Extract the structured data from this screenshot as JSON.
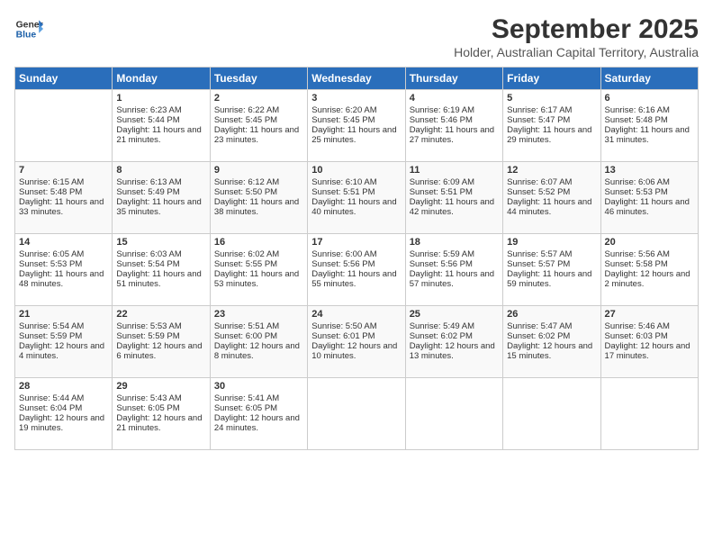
{
  "header": {
    "logo_line1": "General",
    "logo_line2": "Blue",
    "month": "September 2025",
    "location": "Holder, Australian Capital Territory, Australia"
  },
  "days_of_week": [
    "Sunday",
    "Monday",
    "Tuesday",
    "Wednesday",
    "Thursday",
    "Friday",
    "Saturday"
  ],
  "weeks": [
    [
      {
        "day": "",
        "sunrise": "",
        "sunset": "",
        "daylight": ""
      },
      {
        "day": "1",
        "sunrise": "Sunrise: 6:23 AM",
        "sunset": "Sunset: 5:44 PM",
        "daylight": "Daylight: 11 hours and 21 minutes."
      },
      {
        "day": "2",
        "sunrise": "Sunrise: 6:22 AM",
        "sunset": "Sunset: 5:45 PM",
        "daylight": "Daylight: 11 hours and 23 minutes."
      },
      {
        "day": "3",
        "sunrise": "Sunrise: 6:20 AM",
        "sunset": "Sunset: 5:45 PM",
        "daylight": "Daylight: 11 hours and 25 minutes."
      },
      {
        "day": "4",
        "sunrise": "Sunrise: 6:19 AM",
        "sunset": "Sunset: 5:46 PM",
        "daylight": "Daylight: 11 hours and 27 minutes."
      },
      {
        "day": "5",
        "sunrise": "Sunrise: 6:17 AM",
        "sunset": "Sunset: 5:47 PM",
        "daylight": "Daylight: 11 hours and 29 minutes."
      },
      {
        "day": "6",
        "sunrise": "Sunrise: 6:16 AM",
        "sunset": "Sunset: 5:48 PM",
        "daylight": "Daylight: 11 hours and 31 minutes."
      }
    ],
    [
      {
        "day": "7",
        "sunrise": "Sunrise: 6:15 AM",
        "sunset": "Sunset: 5:48 PM",
        "daylight": "Daylight: 11 hours and 33 minutes."
      },
      {
        "day": "8",
        "sunrise": "Sunrise: 6:13 AM",
        "sunset": "Sunset: 5:49 PM",
        "daylight": "Daylight: 11 hours and 35 minutes."
      },
      {
        "day": "9",
        "sunrise": "Sunrise: 6:12 AM",
        "sunset": "Sunset: 5:50 PM",
        "daylight": "Daylight: 11 hours and 38 minutes."
      },
      {
        "day": "10",
        "sunrise": "Sunrise: 6:10 AM",
        "sunset": "Sunset: 5:51 PM",
        "daylight": "Daylight: 11 hours and 40 minutes."
      },
      {
        "day": "11",
        "sunrise": "Sunrise: 6:09 AM",
        "sunset": "Sunset: 5:51 PM",
        "daylight": "Daylight: 11 hours and 42 minutes."
      },
      {
        "day": "12",
        "sunrise": "Sunrise: 6:07 AM",
        "sunset": "Sunset: 5:52 PM",
        "daylight": "Daylight: 11 hours and 44 minutes."
      },
      {
        "day": "13",
        "sunrise": "Sunrise: 6:06 AM",
        "sunset": "Sunset: 5:53 PM",
        "daylight": "Daylight: 11 hours and 46 minutes."
      }
    ],
    [
      {
        "day": "14",
        "sunrise": "Sunrise: 6:05 AM",
        "sunset": "Sunset: 5:53 PM",
        "daylight": "Daylight: 11 hours and 48 minutes."
      },
      {
        "day": "15",
        "sunrise": "Sunrise: 6:03 AM",
        "sunset": "Sunset: 5:54 PM",
        "daylight": "Daylight: 11 hours and 51 minutes."
      },
      {
        "day": "16",
        "sunrise": "Sunrise: 6:02 AM",
        "sunset": "Sunset: 5:55 PM",
        "daylight": "Daylight: 11 hours and 53 minutes."
      },
      {
        "day": "17",
        "sunrise": "Sunrise: 6:00 AM",
        "sunset": "Sunset: 5:56 PM",
        "daylight": "Daylight: 11 hours and 55 minutes."
      },
      {
        "day": "18",
        "sunrise": "Sunrise: 5:59 AM",
        "sunset": "Sunset: 5:56 PM",
        "daylight": "Daylight: 11 hours and 57 minutes."
      },
      {
        "day": "19",
        "sunrise": "Sunrise: 5:57 AM",
        "sunset": "Sunset: 5:57 PM",
        "daylight": "Daylight: 11 hours and 59 minutes."
      },
      {
        "day": "20",
        "sunrise": "Sunrise: 5:56 AM",
        "sunset": "Sunset: 5:58 PM",
        "daylight": "Daylight: 12 hours and 2 minutes."
      }
    ],
    [
      {
        "day": "21",
        "sunrise": "Sunrise: 5:54 AM",
        "sunset": "Sunset: 5:59 PM",
        "daylight": "Daylight: 12 hours and 4 minutes."
      },
      {
        "day": "22",
        "sunrise": "Sunrise: 5:53 AM",
        "sunset": "Sunset: 5:59 PM",
        "daylight": "Daylight: 12 hours and 6 minutes."
      },
      {
        "day": "23",
        "sunrise": "Sunrise: 5:51 AM",
        "sunset": "Sunset: 6:00 PM",
        "daylight": "Daylight: 12 hours and 8 minutes."
      },
      {
        "day": "24",
        "sunrise": "Sunrise: 5:50 AM",
        "sunset": "Sunset: 6:01 PM",
        "daylight": "Daylight: 12 hours and 10 minutes."
      },
      {
        "day": "25",
        "sunrise": "Sunrise: 5:49 AM",
        "sunset": "Sunset: 6:02 PM",
        "daylight": "Daylight: 12 hours and 13 minutes."
      },
      {
        "day": "26",
        "sunrise": "Sunrise: 5:47 AM",
        "sunset": "Sunset: 6:02 PM",
        "daylight": "Daylight: 12 hours and 15 minutes."
      },
      {
        "day": "27",
        "sunrise": "Sunrise: 5:46 AM",
        "sunset": "Sunset: 6:03 PM",
        "daylight": "Daylight: 12 hours and 17 minutes."
      }
    ],
    [
      {
        "day": "28",
        "sunrise": "Sunrise: 5:44 AM",
        "sunset": "Sunset: 6:04 PM",
        "daylight": "Daylight: 12 hours and 19 minutes."
      },
      {
        "day": "29",
        "sunrise": "Sunrise: 5:43 AM",
        "sunset": "Sunset: 6:05 PM",
        "daylight": "Daylight: 12 hours and 21 minutes."
      },
      {
        "day": "30",
        "sunrise": "Sunrise: 5:41 AM",
        "sunset": "Sunset: 6:05 PM",
        "daylight": "Daylight: 12 hours and 24 minutes."
      },
      {
        "day": "",
        "sunrise": "",
        "sunset": "",
        "daylight": ""
      },
      {
        "day": "",
        "sunrise": "",
        "sunset": "",
        "daylight": ""
      },
      {
        "day": "",
        "sunrise": "",
        "sunset": "",
        "daylight": ""
      },
      {
        "day": "",
        "sunrise": "",
        "sunset": "",
        "daylight": ""
      }
    ]
  ]
}
